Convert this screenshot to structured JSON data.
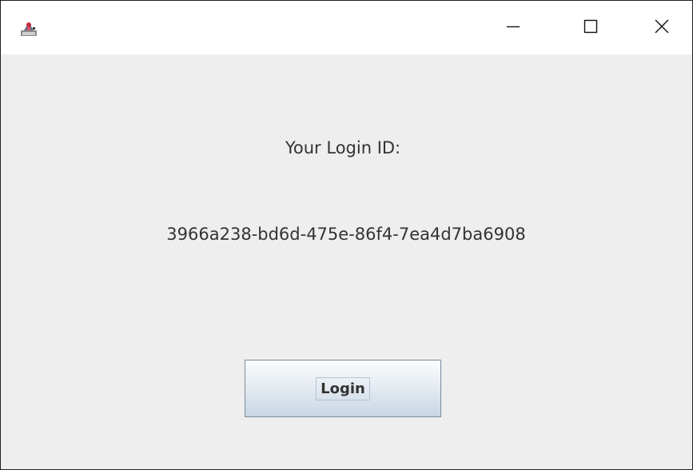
{
  "window": {
    "title": "",
    "controls": {
      "minimize_icon": "minimize-icon",
      "maximize_icon": "maximize-icon",
      "close_icon": "close-icon"
    }
  },
  "main": {
    "heading": "Your Login ID:",
    "login_id": "3966a238-bd6d-475e-86f4-7ea4d7ba6908",
    "login_button_label": "Login"
  },
  "colors": {
    "background": "#eeeeee",
    "titlebar": "#ffffff",
    "text": "#333333",
    "button_border": "#7a8a99"
  }
}
